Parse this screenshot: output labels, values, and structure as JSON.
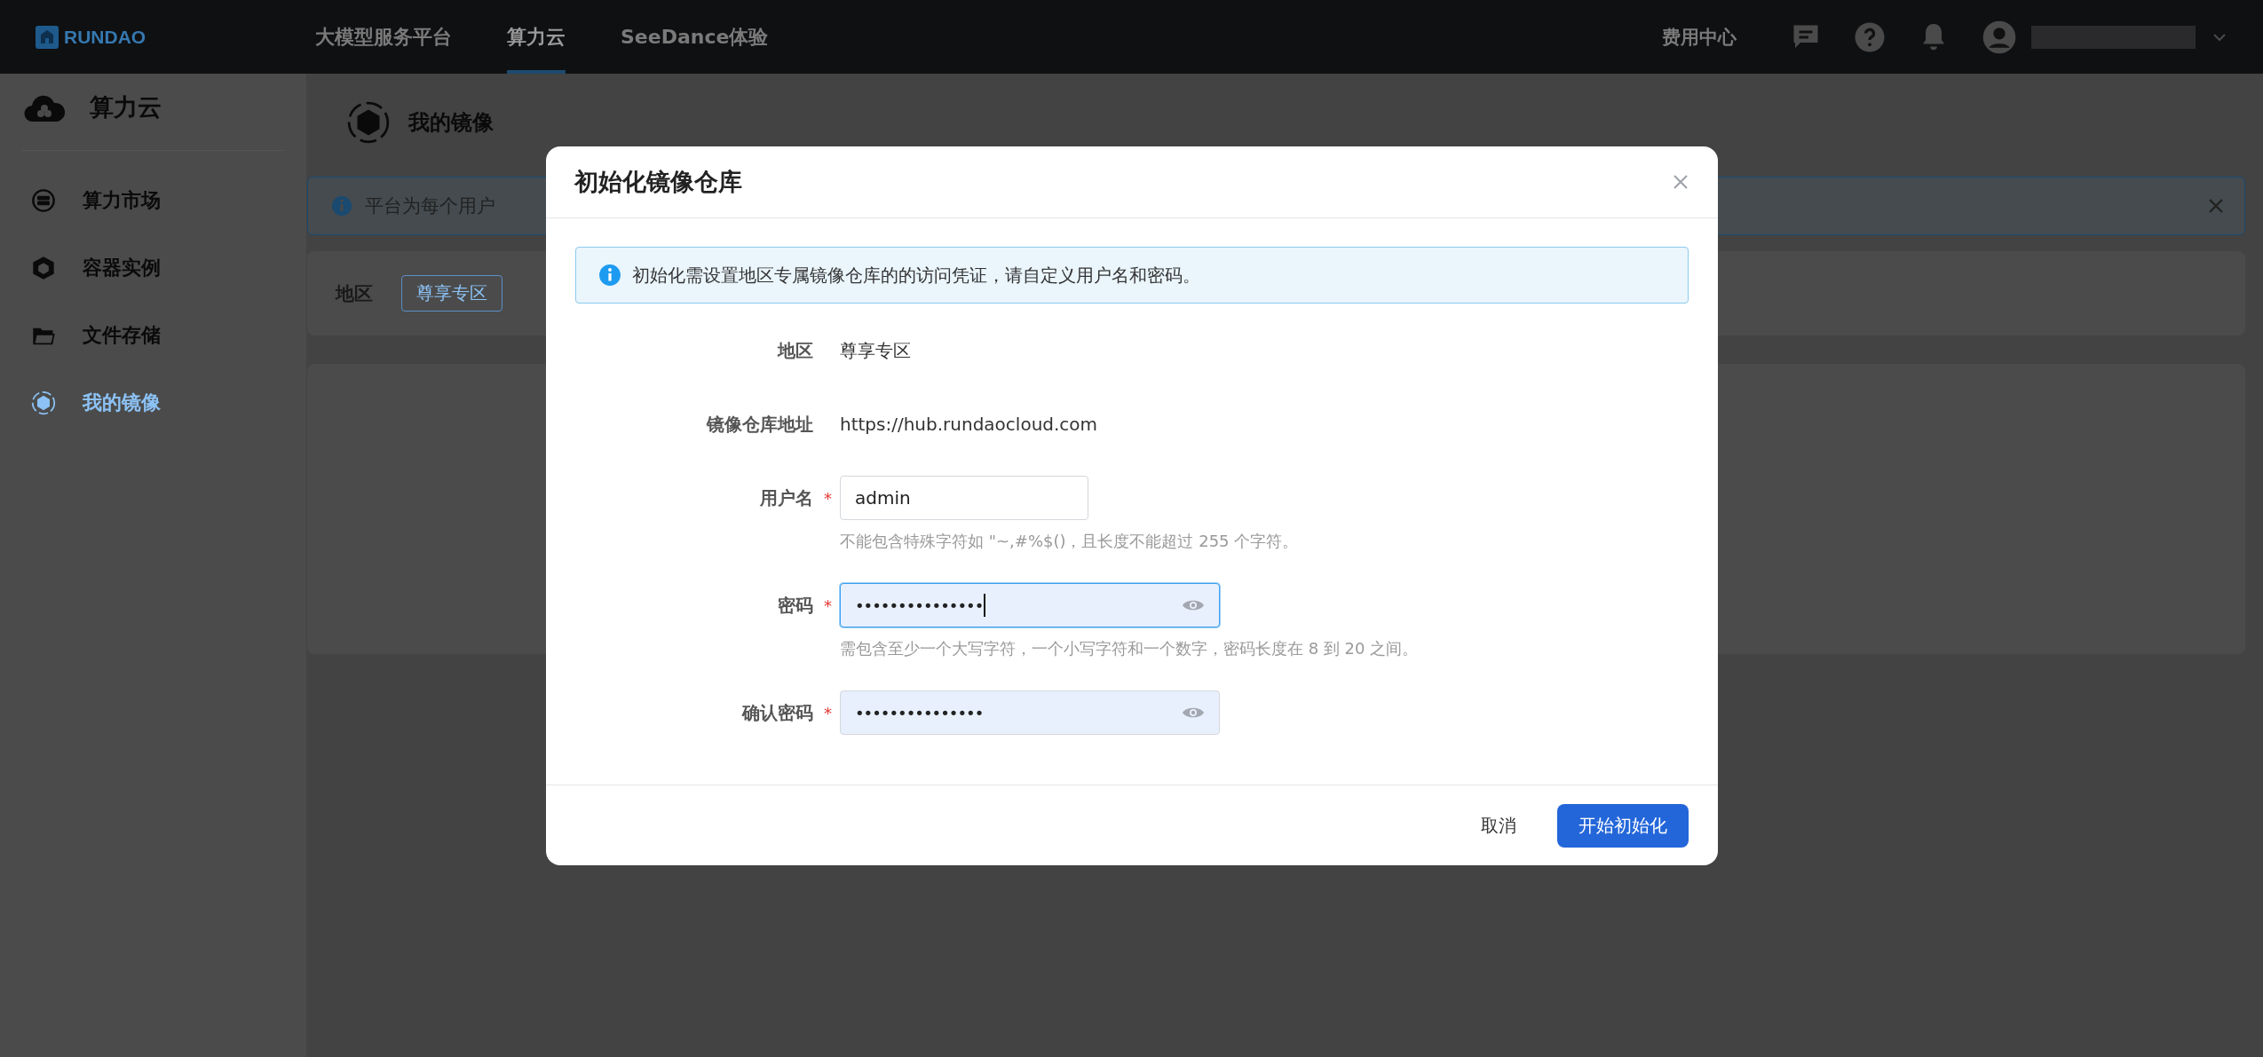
{
  "top_bar": {
    "logo": "RUNDAO",
    "nav": [
      {
        "label": "大模型服务平台",
        "selected": false
      },
      {
        "label": "算力云",
        "selected": true
      },
      {
        "label": "SeeDance体验",
        "selected": false
      }
    ],
    "billing": "费用中心"
  },
  "sidebar": {
    "title": "算力云",
    "items": [
      {
        "label": "算力市场",
        "kind": "market",
        "selected": false
      },
      {
        "label": "容器实例",
        "kind": "container",
        "selected": false
      },
      {
        "label": "文件存储",
        "kind": "folder",
        "selected": false
      },
      {
        "label": "我的镜像",
        "kind": "image",
        "selected": true
      }
    ]
  },
  "page": {
    "title": "我的镜像",
    "alert": "平台为每个用户",
    "filter_label": "地区",
    "filter_option": "尊享专区"
  },
  "dialog": {
    "title": "初始化镜像仓库",
    "info": "初始化需设置地区专属镜像仓库的的访问凭证，请自定义用户名和密码。",
    "fields": [
      {
        "kind": "text",
        "label": "地区",
        "value": "尊享专区"
      },
      {
        "kind": "text",
        "label": "镜像仓库地址",
        "value": "https://hub.rundaocloud.com"
      },
      {
        "kind": "input",
        "label": "用户名",
        "required_mark": "*",
        "value": "admin",
        "focused": false,
        "hint": "不能包含特殊字符如 \"~,#%$()，且长度不能超过 255 个字符。"
      },
      {
        "kind": "password",
        "label": "密码",
        "required_mark": "*",
        "value": "•••••••••••••••",
        "focused": true,
        "hint": "需包含至少一个大写字符，一个小写字符和一个数字，密码长度在 8 到 20 之间。"
      },
      {
        "kind": "password",
        "label": "确认密码",
        "required_mark": "*",
        "value": "•••••••••••••••",
        "focused": false
      }
    ],
    "cancel": "取消",
    "confirm": "开始初始化"
  }
}
